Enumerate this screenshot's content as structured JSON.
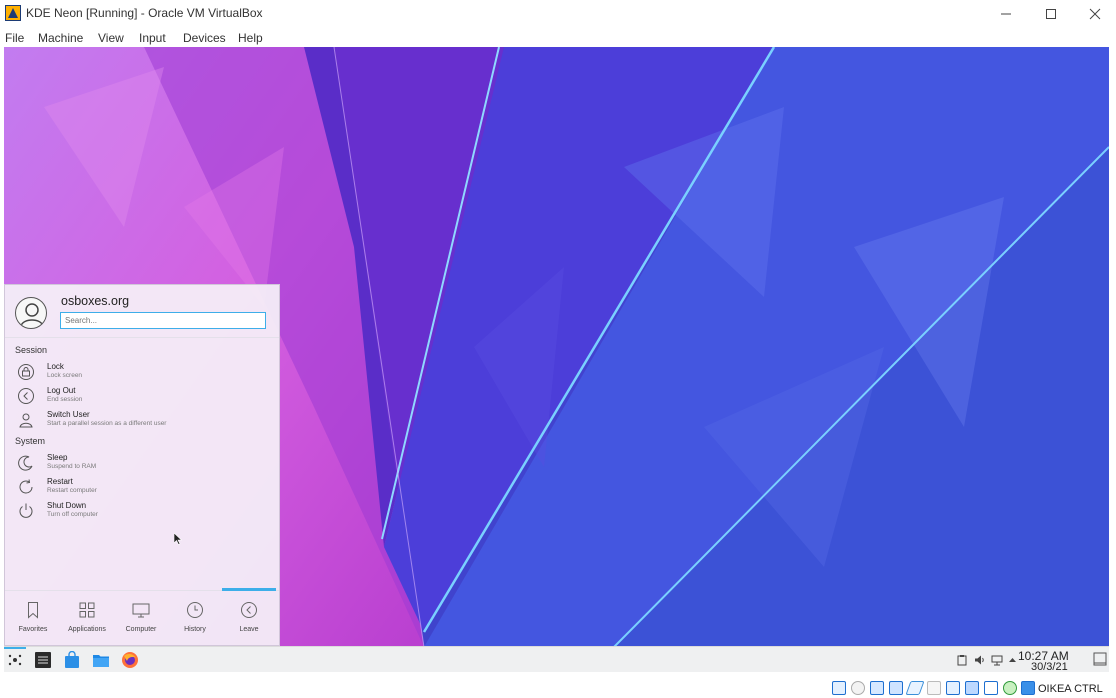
{
  "window": {
    "title": "KDE Neon [Running] - Oracle VM VirtualBox",
    "controls": [
      "minimize",
      "maximize",
      "close"
    ]
  },
  "menubar": {
    "items": [
      "File",
      "Machine",
      "View",
      "Input",
      "Devices",
      "Help"
    ]
  },
  "launcher": {
    "user": "osboxes.org",
    "search_placeholder": "Search...",
    "sections": [
      {
        "title": "Session",
        "entries": [
          {
            "label": "Lock",
            "sub": "Lock screen",
            "icon": "lock-icon"
          },
          {
            "label": "Log Out",
            "sub": "End session",
            "icon": "logout-icon"
          },
          {
            "label": "Switch User",
            "sub": "Start a parallel session as a different user",
            "icon": "switch-user-icon"
          }
        ]
      },
      {
        "title": "System",
        "entries": [
          {
            "label": "Sleep",
            "sub": "Suspend to RAM",
            "icon": "sleep-icon"
          },
          {
            "label": "Restart",
            "sub": "Restart computer",
            "icon": "restart-icon"
          },
          {
            "label": "Shut Down",
            "sub": "Turn off computer",
            "icon": "power-icon"
          }
        ]
      }
    ],
    "tabs": [
      {
        "label": "Favorites",
        "icon": "bookmark-icon"
      },
      {
        "label": "Applications",
        "icon": "grid-icon"
      },
      {
        "label": "Computer",
        "icon": "monitor-icon"
      },
      {
        "label": "History",
        "icon": "clock-icon"
      },
      {
        "label": "Leave",
        "icon": "back-icon",
        "active": true
      }
    ]
  },
  "taskbar": {
    "time": "10:27 AM",
    "date": "30/3/21"
  },
  "statusbar": {
    "host_key": "OIKEA CTRL"
  },
  "colors": {
    "accent": "#3daee9",
    "wallpaper_left": "#c04fd6",
    "wallpaper_right": "#3b4fd8"
  }
}
